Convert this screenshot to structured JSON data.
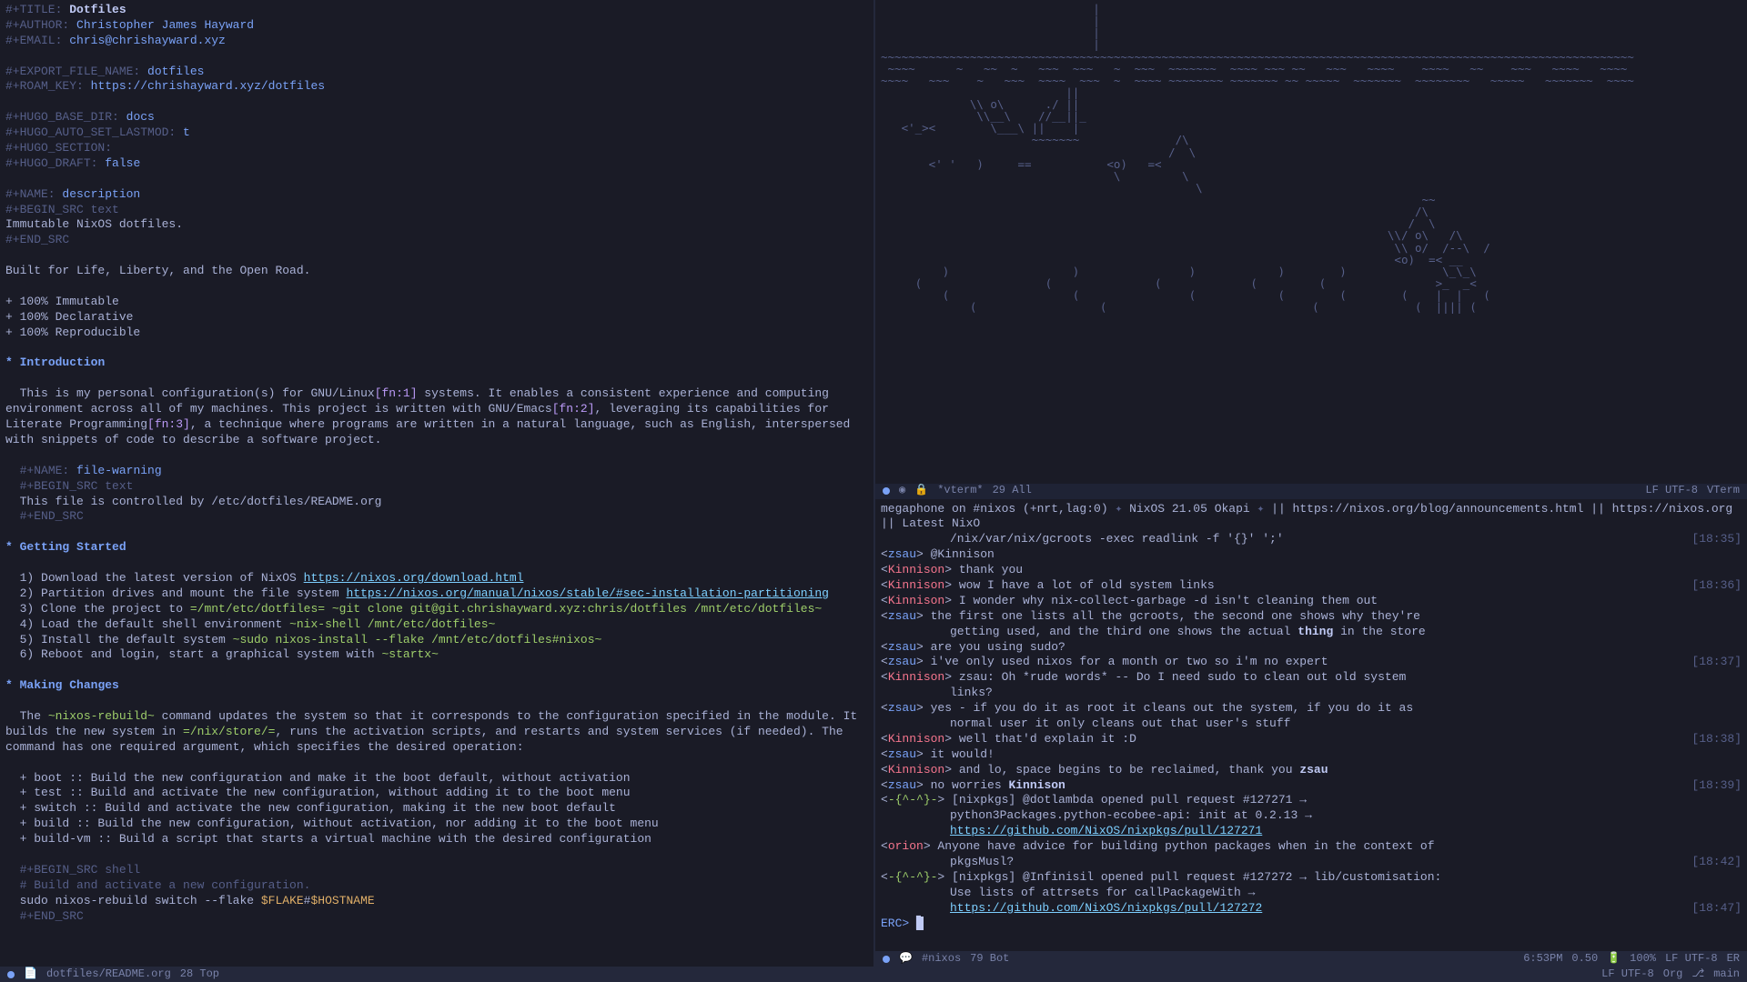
{
  "left": {
    "title_kw": "#+TITLE:",
    "title": "Dotfiles",
    "author_kw": "#+AUTHOR:",
    "author": "Christopher James Hayward",
    "email_kw": "#+EMAIL:",
    "email": "chris@chrishayward.xyz",
    "export_kw": "#+EXPORT_FILE_NAME:",
    "export": "dotfiles",
    "roam_kw": "#+ROAM_KEY:",
    "roam": "https://chrishayward.xyz/dotfiles",
    "hugo_base_kw": "#+HUGO_BASE_DIR:",
    "hugo_base": "docs",
    "hugo_lastmod_kw": "#+HUGO_AUTO_SET_LASTMOD:",
    "hugo_lastmod": "t",
    "hugo_section_kw": "#+HUGO_SECTION:",
    "hugo_draft_kw": "#+HUGO_DRAFT:",
    "hugo_draft": "false",
    "name_desc_kw": "#+NAME:",
    "name_desc": "description",
    "begin_src_text": "#+BEGIN_SRC text",
    "desc_body": "Immutable NixOS dotfiles.",
    "end_src": "#+END_SRC",
    "tagline": "Built for Life, Liberty, and the Open Road.",
    "bullet1": "+ 100% Immutable",
    "bullet2": "+ 100% Declarative",
    "bullet3": "+ 100% Reproducible",
    "h_intro": "Introduction",
    "intro_p1a": "This is my personal configuration(s) for GNU/Linux",
    "fn1": "[fn:1]",
    "intro_p1b": " systems. It enables a consistent experience and computing environment across all of my machines. This project is written with GNU/Emacs",
    "fn2": "[fn:2]",
    "intro_p1c": ", leveraging its capabilities for Literate Programming",
    "fn3": "[fn:3]",
    "intro_p1d": ", a technique where programs are written in a natural language, such as English, interspersed with snippets of code to describe a software project.",
    "name_fw": "file-warning",
    "fw_body": "This file is controlled by /etc/dotfiles/README.org",
    "h_gs": "Getting Started",
    "gs1a": "1) Download the latest version of NixOS ",
    "gs1b": "https://nixos.org/download.html",
    "gs2a": "2) Partition drives and mount the file system ",
    "gs2b": "https://nixos.org/manual/nixos/stable/#sec-installation-partitioning",
    "gs3a": "3) Clone the project to ",
    "gs3b": "=/mnt/etc/dotfiles=",
    "gs3c": " ~git clone git@git.chrishayward.xyz:chris/dotfiles /mnt/etc/dotfiles~",
    "gs4a": "4) Load the default shell environment ",
    "gs4b": "~nix-shell /mnt/etc/dotfiles~",
    "gs5a": "5) Install the default system ",
    "gs5b": "~sudo nixos-install --flake /mnt/etc/dotfiles#nixos~",
    "gs6a": "6) Reboot and login, start a graphical system with ",
    "gs6b": "~startx~",
    "h_mc": "Making Changes",
    "mc_p1a": "The ",
    "mc_p1b": "~nixos-rebuild~",
    "mc_p1c": " command updates the system so that it corresponds to the configuration specified in the module. It builds the new system in ",
    "mc_p1d": "=/nix/store/=",
    "mc_p1e": ", runs the activation scripts, and restarts and system services (if needed). The command has one required argument, which specifies the desired operation:",
    "op1": "+ boot :: Build the new configuration and make it the boot default, without activation",
    "op2": "+ test :: Build and activate the new configuration, without adding it to the boot menu",
    "op3": "+ switch :: Build and activate the new configuration, making it the new boot default",
    "op4": "+ build :: Build the new configuration, without activation, nor adding it to the boot menu",
    "op5": "+ build-vm :: Build a script that starts a virtual machine with the desired configuration",
    "begin_src_shell": "#+BEGIN_SRC shell",
    "shell_comment": "# Build and activate a new configuration.",
    "shell_cmd_a": "sudo nixos-rebuild switch --flake ",
    "shell_cmd_b": "$FLAKE",
    "shell_cmd_c": "#",
    "shell_cmd_d": "$HOSTNAME"
  },
  "ascii_art": "                               |\n                               |\n                               |\n                               |\n~~~~~~~~~~~~~~~~~~~~~~~~~~~~~~~~~~~~~~~~~~~~~~~~~~~~~~~~~~~~~~~~~~~~~~~~~~~~~~~~~~~~~~~~~~~~~~~~~~~~~~~~~~~~~~\n ~~~~      ~   ~~  ~   ~~~  ~~~   ~  ~~~  ~~~~~~~  ~~~~ ~~~ ~~   ~~~   ~~~~    ~~~~   ~~    ~~~   ~~~~   ~~~~\n~~~~   ~~~    ~   ~~~  ~~~~  ~~~  ~  ~~~~ ~~~~~~~~ ~~~~~~~ ~~ ~~~~~  ~~~~~~~  ~~~~~~~~   ~~~~~   ~~~~~~~  ~~~~\n                           ||\n             \\\\ o\\      ./ ||\n              \\\\__\\    //__||_\n   <'_><        \\___\\ ||    |\n                      ~~~~~~~              /\\\n                                          /  \\\n       <' '   )     ==           <o)   =<\n                                  \\         \\\n                                              \\\n                                                                               ~~\n                                                                              /\\\n                                                                             /  \\\n                                                                          \\\\/ o\\   /\\\n                                                                           \\\\ o/  /--\\  /\n                                                                           <o)  =< __\n         )                  )                )            )        )              \\_\\_\\\n     (                  (               (             (         (                >_  _<\n         (                  (                (            (        (        (    |  |   (\n             (                  (                              (              (  |||| (",
  "vterm_modeline": {
    "lock_icon": "🔒",
    "bufname": "*vterm*",
    "pos": "29 All",
    "right1": "LF UTF-8",
    "right2": "VTerm"
  },
  "irc": {
    "topic_a": "megaphone on #nixos (+nrt,lag:0) ",
    "topic_b": " NixOS 21.05 Okapi ",
    "topic_c": " || https://nixos.org/blog/announcements.html || https://nixos.org || Latest NixO",
    "topic_line2": "/nix/var/nix/gcroots -exec readlink -f '{}' ';'",
    "ts_topic": "[18:35]",
    "lines": [
      {
        "nick": "zsau",
        "nc": "nick2",
        "text": "@Kinnison",
        "ts": ""
      },
      {
        "nick": "Kinnison",
        "nc": "nick1",
        "text": "thank you",
        "ts": ""
      },
      {
        "nick": "Kinnison",
        "nc": "nick1",
        "text": "wow I have a lot of old system links",
        "ts": "[18:36]"
      },
      {
        "nick": "Kinnison",
        "nc": "nick1",
        "text": "I wonder why nix-collect-garbage -d isn't cleaning them out",
        "ts": ""
      },
      {
        "nick": "zsau",
        "nc": "nick2",
        "text": "the first one lists all the gcroots, the second one shows why they're",
        "ts": ""
      },
      {
        "indent": true,
        "text_a": "getting used, and the third one shows the actual ",
        "bold": "thing",
        "text_b": " in the store"
      },
      {
        "nick": "zsau",
        "nc": "nick2",
        "text": "are you using sudo?",
        "ts": ""
      },
      {
        "nick": "zsau",
        "nc": "nick2",
        "text": "i've only used nixos for a month or two so i'm no expert",
        "ts": "[18:37]"
      },
      {
        "nick": "Kinnison",
        "nc": "nick1",
        "text": "zsau: Oh *rude words* -- Do I need sudo to clean out old system",
        "ts": ""
      },
      {
        "indent": true,
        "text_a": "links?"
      },
      {
        "nick": "zsau",
        "nc": "nick2",
        "text": "yes - if you do it as root it cleans out the system, if you do it as",
        "ts": ""
      },
      {
        "indent": true,
        "text_a": "normal user it only cleans out that user's stuff"
      },
      {
        "nick": "Kinnison",
        "nc": "nick1",
        "text": "well that'd explain it :D",
        "ts": "[18:38]"
      },
      {
        "nick": "zsau",
        "nc": "nick2",
        "text": "it would!",
        "ts": ""
      },
      {
        "nick": "Kinnison",
        "nc": "nick1",
        "text_a": "and lo, space begins to be reclaimed, thank you ",
        "nick_ref": "zsau",
        "ts": ""
      },
      {
        "nick": "zsau",
        "nc": "nick2",
        "text_a": "no worries ",
        "nick_ref": "Kinnison",
        "ts": "[18:39]"
      },
      {
        "nick": "-{^-^}-",
        "nc": "nick3",
        "text": "[nixpkgs] @dotlambda opened pull request #127271 →",
        "ts": ""
      },
      {
        "indent": true,
        "text_a": "python3Packages.python-ecobee-api: init at 0.2.13 →"
      },
      {
        "indent": true,
        "url": "https://github.com/NixOS/nixpkgs/pull/127271"
      },
      {
        "nick": "orion",
        "nc": "nick1",
        "text": "Anyone have advice for building python packages when in the context of",
        "ts": ""
      },
      {
        "indent": true,
        "text_a": "pkgsMusl?",
        "ts": "[18:42]"
      },
      {
        "nick": "-{^-^}-",
        "nc": "nick3",
        "text": "[nixpkgs] @Infinisil opened pull request #127272 → lib/customisation:",
        "ts": ""
      },
      {
        "indent": true,
        "text_a": "Use lists of attrsets for callPackageWith →"
      },
      {
        "indent": true,
        "url": "https://github.com/NixOS/nixpkgs/pull/127272",
        "ts": "[18:47]"
      }
    ],
    "prompt": "ERC>",
    "prompt_cursor": "▋"
  },
  "irc_modeline": {
    "bufname": "#nixos",
    "pos": "79 Bot",
    "time": "6:53PM",
    "load": "0.50",
    "batt_icon": "🔋",
    "batt": "100%",
    "enc": "LF UTF-8",
    "mode": "ER"
  },
  "bottom_modeline": {
    "bufname": "dotfiles/README.org",
    "pos": "28 Top",
    "enc": "LF UTF-8",
    "mode": "Org",
    "branch_icon": "⎇",
    "branch": "main"
  }
}
